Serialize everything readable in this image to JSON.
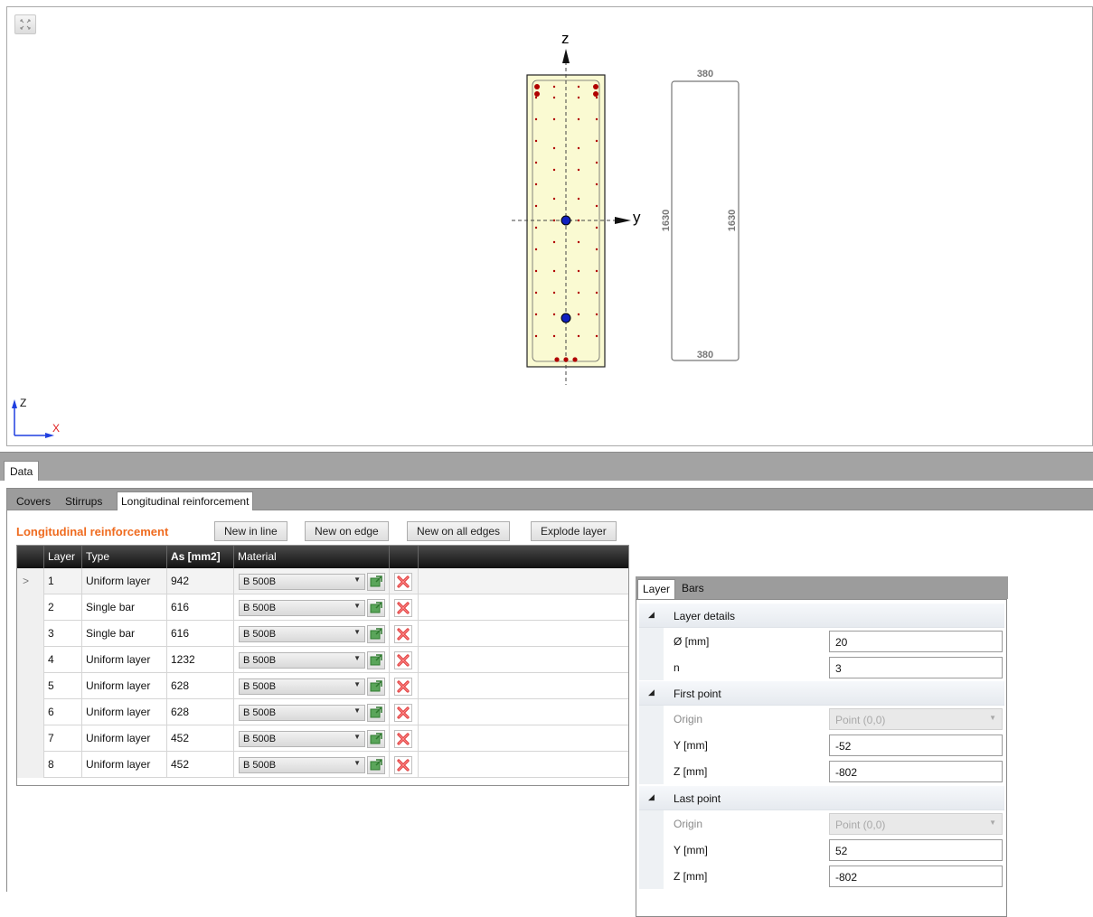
{
  "drawing": {
    "axes": {
      "z": "z",
      "y": "y"
    },
    "dimensions": {
      "top": "380",
      "bottom": "380",
      "left": "1630",
      "right": "1630"
    },
    "gizmo": {
      "z": "Z",
      "x": "X"
    }
  },
  "tabs": {
    "data": "Data"
  },
  "subtabs": [
    "Covers",
    "Stirrups",
    "Longitudinal reinforcement"
  ],
  "section": {
    "title": "Longitudinal reinforcement",
    "buttons": [
      "New in line",
      "New on edge",
      "New on all edges",
      "Explode layer"
    ]
  },
  "grid": {
    "headers": {
      "layer": "Layer",
      "type": "Type",
      "as": "As [mm2]",
      "material": "Material"
    },
    "selected_marker": ">",
    "rows": [
      {
        "layer": "1",
        "type": "Uniform layer",
        "as": "942",
        "material": "B 500B"
      },
      {
        "layer": "2",
        "type": "Single bar",
        "as": "616",
        "material": "B 500B"
      },
      {
        "layer": "3",
        "type": "Single bar",
        "as": "616",
        "material": "B 500B"
      },
      {
        "layer": "4",
        "type": "Uniform layer",
        "as": "1232",
        "material": "B 500B"
      },
      {
        "layer": "5",
        "type": "Uniform layer",
        "as": "628",
        "material": "B 500B"
      },
      {
        "layer": "6",
        "type": "Uniform layer",
        "as": "628",
        "material": "B 500B"
      },
      {
        "layer": "7",
        "type": "Uniform layer",
        "as": "452",
        "material": "B 500B"
      },
      {
        "layer": "8",
        "type": "Uniform layer",
        "as": "452",
        "material": "B 500B"
      }
    ]
  },
  "props": {
    "tabs": [
      "Layer",
      "Bars"
    ],
    "layer_details": {
      "title": "Layer details",
      "diameter_label": "Ø [mm]",
      "diameter": "20",
      "n_label": "n",
      "n": "3"
    },
    "first_point": {
      "title": "First point",
      "origin_label": "Origin",
      "origin": "Point (0,0)",
      "y_label": "Y [mm]",
      "y": "-52",
      "z_label": "Z [mm]",
      "z": "-802"
    },
    "last_point": {
      "title": "Last point",
      "origin_label": "Origin",
      "origin": "Point (0,0)",
      "y_label": "Y [mm]",
      "y": "52",
      "z_label": "Z [mm]",
      "z": "-802"
    }
  },
  "colors": {
    "accent": "#ef6b1f",
    "concrete": "#fafad2",
    "rebar": "#b00000",
    "centroid": "#1020c0"
  }
}
